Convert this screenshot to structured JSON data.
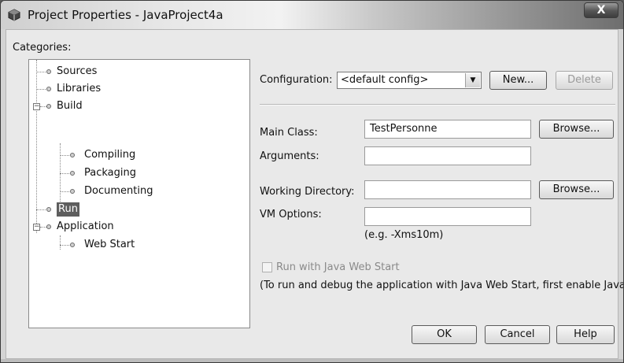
{
  "window": {
    "title": "Project Properties - JavaProject4a",
    "close_glyph": "X"
  },
  "categories_label": "Categories:",
  "tree": {
    "sources": "Sources",
    "libraries": "Libraries",
    "build": "Build",
    "compiling": "Compiling",
    "packaging": "Packaging",
    "documenting": "Documenting",
    "run": "Run",
    "application": "Application",
    "web_start": "Web Start"
  },
  "form": {
    "configuration_label": "Configuration:",
    "configuration_value": "<default config>",
    "new_button": "New...",
    "delete_button": "Delete",
    "main_class_label": "Main Class:",
    "main_class_value": "TestPersonne",
    "browse_button_1": "Browse...",
    "arguments_label": "Arguments:",
    "arguments_value": "",
    "working_dir_label": "Working Directory:",
    "working_dir_value": "",
    "browse_button_2": "Browse...",
    "vm_options_label": "VM Options:",
    "vm_options_value": "",
    "vm_options_hint": "(e.g. -Xms10m)",
    "web_start_checkbox_label": "Run with Java Web Start",
    "web_start_note": "(To run and debug the application with Java Web Start, first enable Java"
  },
  "buttons": {
    "ok": "OK",
    "cancel": "Cancel",
    "help": "Help"
  }
}
